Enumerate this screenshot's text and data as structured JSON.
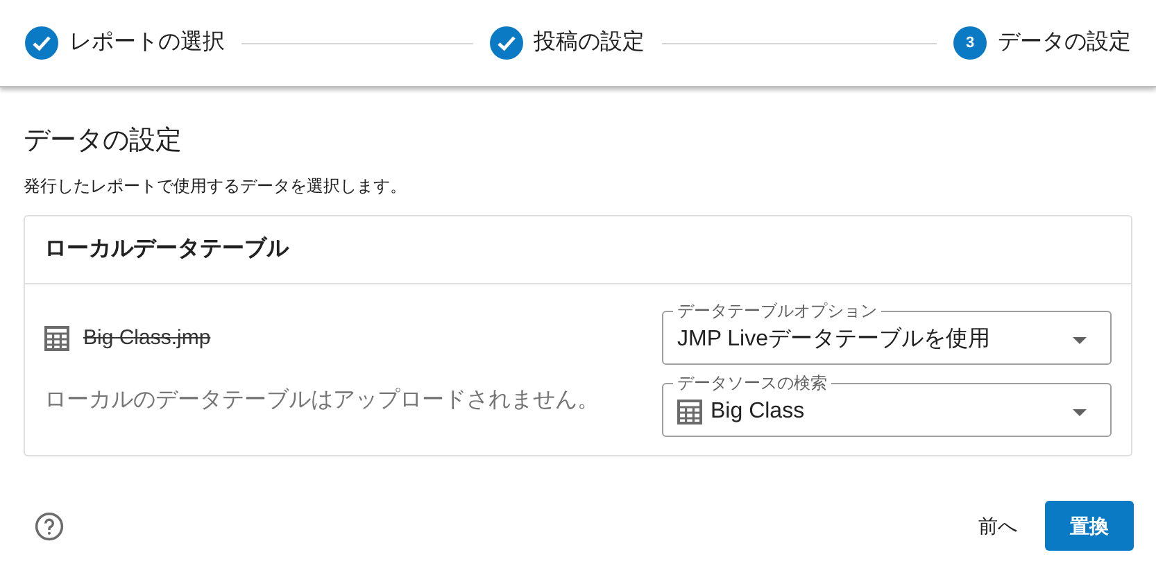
{
  "steps": [
    {
      "label": "レポートの選択",
      "completed": true
    },
    {
      "label": "投稿の設定",
      "completed": true
    },
    {
      "label": "データの設定",
      "number": "3",
      "completed": false
    }
  ],
  "section": {
    "title": "データの設定",
    "description": "発行したレポートで使用するデータを選択します。"
  },
  "card": {
    "title": "ローカルデータテーブル",
    "file": {
      "name": "Big Class.jmp",
      "struck": true
    },
    "note": "ローカルのデータテーブルはアップロードされません。",
    "fields": [
      {
        "label": "データテーブルオプション",
        "value": "JMP Liveデータテーブルを使用",
        "kind": "plain"
      },
      {
        "label": "データソースの検索",
        "value": "Big Class",
        "kind": "table"
      }
    ]
  },
  "footer": {
    "back": "前へ",
    "primary": "置換"
  }
}
